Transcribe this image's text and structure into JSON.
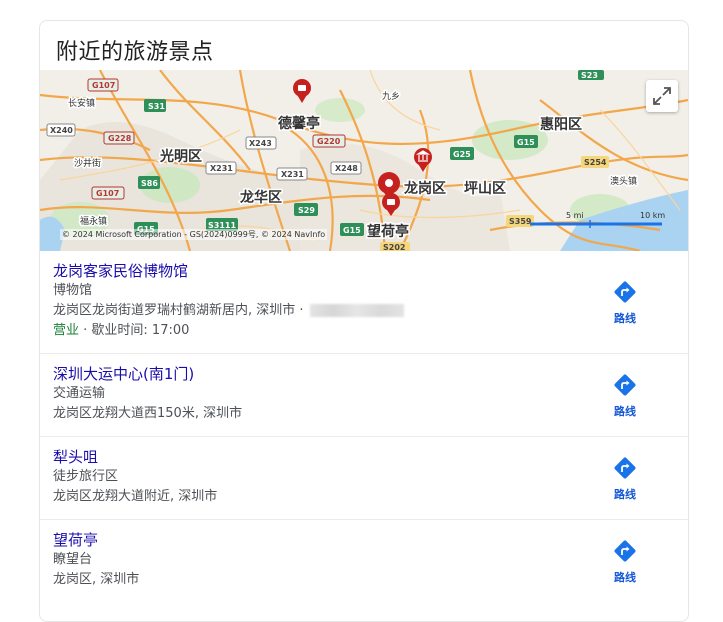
{
  "card": {
    "title": "附近的旅游景点"
  },
  "map": {
    "copyright": "© 2024 Microsoft Corporation - GS(2024)0999号, © 2024 NavInfo",
    "scale_mi": "5 mi",
    "scale_km": "10 km",
    "places": {
      "deqinting": "德馨亭",
      "longgangqu": "龙岗区",
      "pingshanqu": "坪山区",
      "huiyangqu": "惠阳区",
      "guangmingqu": "光明区",
      "longhuaqu": "龙华区",
      "wangheting": "望荷亭",
      "jiuxiang": "九乡",
      "changanzhen": "长安镇",
      "shajingjie": "沙井街",
      "fuyongzhen": "福永镇",
      "aotouzhen": "澳头镇"
    },
    "roads": {
      "g107a": "G107",
      "g107b": "G107",
      "s31": "S31",
      "x240": "X240",
      "g228": "G228",
      "x243": "X243",
      "g220": "G220",
      "x231a": "X231",
      "x231b": "X231",
      "x248": "X248",
      "s86": "S86",
      "s29": "S29",
      "s3111": "S3111",
      "g15a": "G15",
      "g15b": "G15",
      "g15c": "G15",
      "g25": "G25",
      "s254": "S254",
      "s359": "S359",
      "s23": "S23",
      "s202": "S202"
    }
  },
  "results": [
    {
      "title": "龙岗客家民俗博物馆",
      "category": "博物馆",
      "address": "龙岗区龙岗街道罗瑞村鹤湖新居内, 深圳市 ·",
      "status": "营业",
      "hours": "歇业时间: 17:00",
      "directions": "路线"
    },
    {
      "title": "深圳大运中心(南1门)",
      "category": "交通运输",
      "address": "龙岗区龙翔大道西150米, 深圳市",
      "directions": "路线"
    },
    {
      "title": "犁头咀",
      "category": "徒步旅行区",
      "address": "龙岗区龙翔大道附近, 深圳市",
      "directions": "路线"
    },
    {
      "title": "望荷亭",
      "category": "瞭望台",
      "address": "龙岗区, 深圳市",
      "directions": "路线"
    }
  ],
  "colors": {
    "title_link": "#1a0dab",
    "open_status": "#188038",
    "directions": "#1a73e8",
    "pin": "#c5221f"
  },
  "icons": {
    "expand": "expand-icon",
    "directions": "turn-right-arrow-icon",
    "pin": "map-pin-icon",
    "museum": "museum-icon"
  }
}
